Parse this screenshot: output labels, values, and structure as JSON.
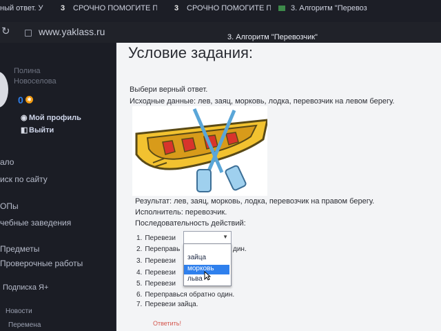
{
  "browser": {
    "tabs": [
      {
        "label": "ный ответ. У",
        "favicon": ""
      },
      {
        "label": "СРОЧНО ПОМОГИТЕ ПО",
        "favicon": "3"
      },
      {
        "label": "СРОЧНО ПОМОГИТЕ ПР",
        "favicon": "3"
      },
      {
        "label": "3. Алгоритм \"Перевоз",
        "favicon": ""
      }
    ],
    "url": "www.yaklass.ru",
    "tooltip": "3. Алгоритм \"Перевозчик\""
  },
  "sidebar": {
    "user_first_name": "Полина",
    "user_last_name": "Новоселова",
    "points": "0",
    "profile_label": "Мой профиль",
    "logout_label": "Выйти",
    "nav": [
      "ало",
      "иск по сайту",
      "ОПы",
      "чебные заведения",
      "Предметы",
      "Проверочные работы",
      "Подписка Я+",
      "Новости",
      "Перемена"
    ]
  },
  "task": {
    "title": "Условие задания:",
    "instruction": "Выбери верный ответ.",
    "source_data": "Исходные данные: лев, заяц, морковь, лодка, перевозчик на левом берегу.",
    "result": "Результат: лев, заяц, морковь, лодка, перевозчик на правом берегу.",
    "executor": "Исполнитель: перевозчик.",
    "sequence_label": "Последовательность действий:",
    "steps": [
      {
        "num": "1.",
        "text": "Перевези"
      },
      {
        "num": "2.",
        "text": "Переправь"
      },
      {
        "num": "3.",
        "text": "Перевези"
      },
      {
        "num": "4.",
        "text": "Перевези"
      },
      {
        "num": "5.",
        "text": "Перевези"
      },
      {
        "num": "6.",
        "text": "Переправься обратно один."
      },
      {
        "num": "7.",
        "text": "Перевези зайца."
      }
    ],
    "step2_tail": "дин.",
    "dropdown_options": [
      "зайца",
      "морковь",
      "льва"
    ],
    "highlighted_option": "морковь",
    "answer_button": "Ответить!"
  },
  "colors": {
    "accent": "#2f80ed",
    "coin": "#f39c12"
  }
}
